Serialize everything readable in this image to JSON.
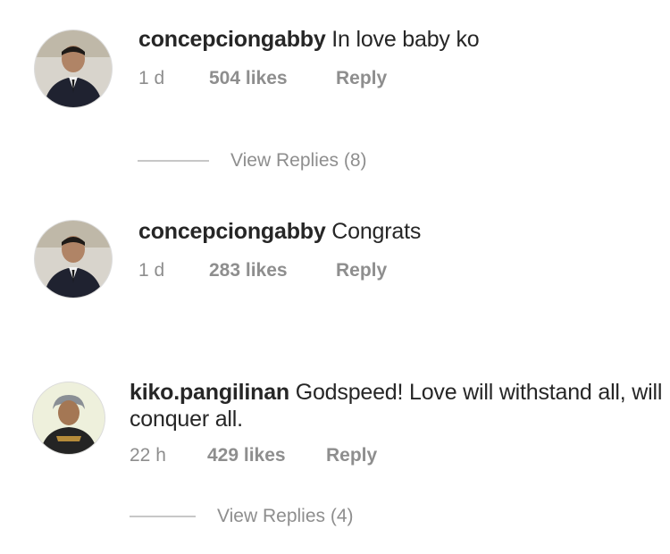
{
  "comments": [
    {
      "username": "concepciongabby",
      "text": "In love baby ko",
      "time": "1 d",
      "likes": "504 likes",
      "reply": "Reply",
      "view_replies": "View Replies (8)"
    },
    {
      "username": "concepciongabby",
      "text": "Congrats",
      "time": "1 d",
      "likes": "283 likes",
      "reply": "Reply"
    },
    {
      "username": "kiko.pangilinan",
      "text_line1": "Godspeed! Love will withstand all, will",
      "text_line2": "conquer all.",
      "time": "22 h",
      "likes": "429 likes",
      "reply": "Reply",
      "view_replies": "View Replies (4)"
    }
  ]
}
